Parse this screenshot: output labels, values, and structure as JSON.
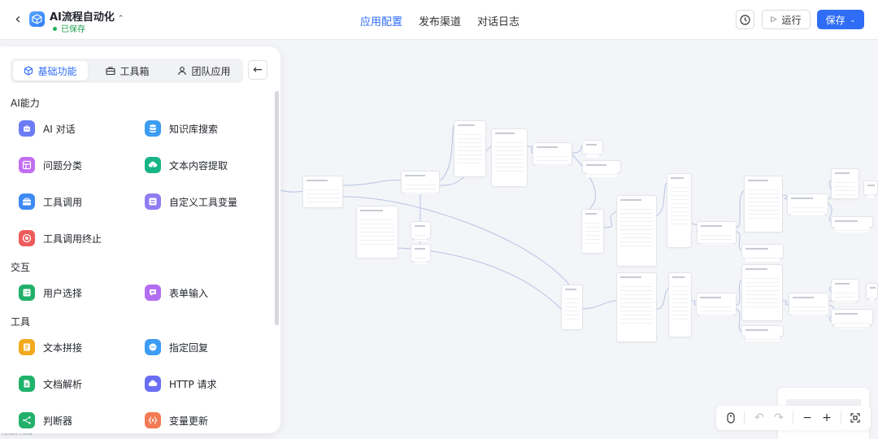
{
  "header": {
    "app_title": "AI流程自动化",
    "save_status": "已保存",
    "nav": [
      "应用配置",
      "发布渠道",
      "对话日志"
    ],
    "run_label": "运行",
    "save_label": "保存"
  },
  "panel": {
    "tabs": [
      "基础功能",
      "工具箱",
      "团队应用"
    ],
    "sections": {
      "ai": "AI能力",
      "interaction": "交互",
      "tools": "工具"
    },
    "items": {
      "ai_chat": "AI 对话",
      "kb_search": "知识库搜索",
      "question_classify": "问题分类",
      "text_extract": "文本内容提取",
      "tool_call": "工具调用",
      "custom_tool_var": "自定义工具变量",
      "tool_call_stop": "工具调用终止",
      "user_select": "用户选择",
      "form_input": "表单输入",
      "text_concat": "文本拼接",
      "reply": "指定回复",
      "doc_parse": "文档解析",
      "http": "HTTP 请求",
      "condition": "判断器",
      "var_update": "变量更新"
    }
  },
  "canvas": {
    "attribution": "React Flow"
  },
  "colors": {
    "accent": "#2f6df6",
    "saved": "#22b254"
  }
}
